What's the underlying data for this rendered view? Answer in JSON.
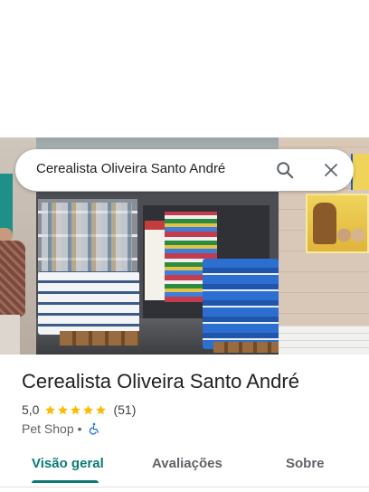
{
  "search": {
    "query": "Cerealista Oliveira Santo André",
    "search_icon": "search-icon",
    "close_icon": "close-icon"
  },
  "photo": {
    "description_icon": "store-photo"
  },
  "place": {
    "name": "Cerealista Oliveira Santo André",
    "rating": "5,0",
    "stars": 5,
    "review_count": "(51)",
    "category": "Pet Shop",
    "separator": "•",
    "accessibility_icon": "wheelchair-icon"
  },
  "tabs": [
    {
      "label": "Visão geral",
      "active": true
    },
    {
      "label": "Avaliações",
      "active": false
    },
    {
      "label": "Sobre",
      "active": false
    }
  ],
  "colors": {
    "accent": "#0b7a75",
    "star": "#fbbc04",
    "accessibility": "#1a73e8"
  }
}
